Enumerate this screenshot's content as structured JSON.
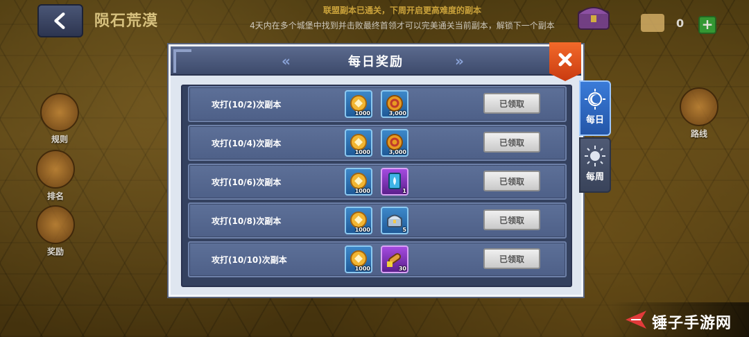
{
  "header": {
    "map_title": "陨石荒漠",
    "notice_line1": "联盟副本已通关，下周开启更高难度的副本",
    "notice_line2": "4天内在多个城堡中找到并击败最终首领才可以完美通关当前副本，解锁下一个副本",
    "map_count": "0"
  },
  "side_buttons": {
    "rules": "规则",
    "ranking": "排名",
    "rewards": "奖励",
    "route": "路线"
  },
  "modal": {
    "title": "每日奖励",
    "arrow_left": "«",
    "arrow_right": "»",
    "tabs": {
      "daily": "每日",
      "weekly": "每周"
    },
    "rows": [
      {
        "label": "攻打(10/2)次副本",
        "reward1_qty": "1000",
        "reward2_qty": "3,000",
        "reward2_type": "coin-icon",
        "button": "已领取"
      },
      {
        "label": "攻打(10/4)次副本",
        "reward1_qty": "1000",
        "reward2_qty": "3,000",
        "reward2_type": "coin-icon",
        "button": "已领取"
      },
      {
        "label": "攻打(10/6)次副本",
        "reward1_qty": "1000",
        "reward2_qty": "1",
        "reward2_type": "card-icon",
        "button": "已领取"
      },
      {
        "label": "攻打(10/8)次副本",
        "reward1_qty": "1000",
        "reward2_qty": "5",
        "reward2_type": "chest-icon",
        "button": "已领取"
      },
      {
        "label": "攻打(10/10)次副本",
        "reward1_qty": "1000",
        "reward2_qty": "30",
        "reward2_type": "scroll-icon",
        "button": "已领取"
      }
    ]
  },
  "watermark": {
    "text": "锤子手游网"
  },
  "colors": {
    "accent_orange": "#e8551c",
    "active_tab": "#2f6bc4",
    "row_bg": "#5a6c93"
  }
}
